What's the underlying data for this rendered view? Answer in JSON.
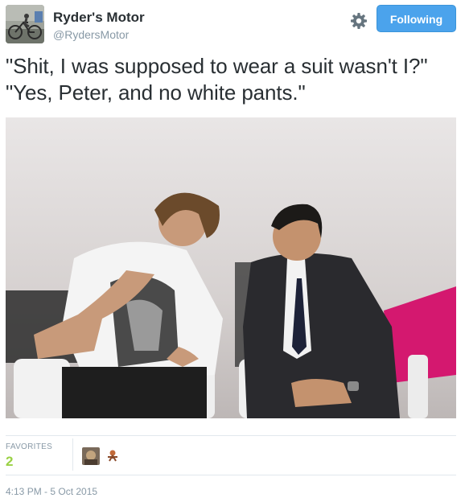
{
  "tweet": {
    "author_name": "Ryder's Motor",
    "author_handle": "@RydersMotor",
    "text": "\"Shit, I was supposed to wear a suit wasn't I?\" \"Yes, Peter, and no white pants.\"",
    "follow_button_label": "Following",
    "favorites_label": "FAVORITES",
    "favorites_count": "2",
    "timestamp": "4:13 PM - 5 Oct 2015"
  },
  "icons": {
    "settings": "gear-icon",
    "avatar": "profile-avatar"
  },
  "colors": {
    "follow_button": "#4ba3ec",
    "favorites_count": "#9ad145",
    "muted_text": "#8899a6",
    "accent_magenta": "#d4186f"
  }
}
